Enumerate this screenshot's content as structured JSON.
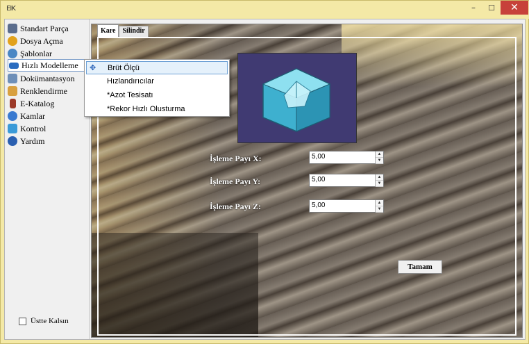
{
  "window": {
    "app_icon_text": "ΕΙΚ",
    "min_glyph": "–",
    "max_glyph": "☐",
    "close_glyph": "✕"
  },
  "sidebar": {
    "items": [
      {
        "label": "Standart Parça",
        "icon": "gear-icon",
        "color": "#5a6c8c"
      },
      {
        "label": "Dosya Açma",
        "icon": "folder-icon",
        "color": "#e2a21c"
      },
      {
        "label": "Şablonlar",
        "icon": "globe-icon",
        "color": "#4a87c4"
      },
      {
        "label": "Hızlı Modelleme",
        "icon": "arrow-icon",
        "color": "#2a6cc0"
      },
      {
        "label": "Dokümantasyon",
        "icon": "document-icon",
        "color": "#6e8fb8"
      },
      {
        "label": "Renklendirme",
        "icon": "palette-icon",
        "color": "#d8a040"
      },
      {
        "label": "E-Katalog",
        "icon": "book-icon",
        "color": "#9c3a28"
      },
      {
        "label": "Kamlar",
        "icon": "cam-icon",
        "color": "#3a7ad0"
      },
      {
        "label": "Kontrol",
        "icon": "check-icon",
        "color": "#3a9ad8"
      },
      {
        "label": "Yardım",
        "icon": "help-icon",
        "color": "#2a5fb0"
      }
    ],
    "keep_on_top_label": "Üstte Kalsın"
  },
  "tabs": [
    {
      "label": "Kare",
      "selected": true
    },
    {
      "label": "Silindir",
      "selected": false
    }
  ],
  "form": {
    "fields": [
      {
        "label": "İşleme Payı X:",
        "value": "5,00"
      },
      {
        "label": "İşleme Payı Y:",
        "value": "5,00"
      },
      {
        "label": "İşleme Payı Z:",
        "value": "5,00"
      }
    ],
    "ok_label": "Tamam"
  },
  "dropdown": {
    "items": [
      {
        "label": "Brüt Ölçü",
        "highlighted": true
      },
      {
        "label": "Hızlandırıcılar",
        "highlighted": false
      },
      {
        "label": "*Azot Tesisatı",
        "highlighted": false
      },
      {
        "label": "*Rekor Hızlı Olusturma",
        "highlighted": false
      }
    ]
  },
  "colors": {
    "titlebar": "#f4e9a6",
    "close": "#c7413a",
    "shape_bg": "#403a72",
    "cube": "#3eb0cf"
  }
}
